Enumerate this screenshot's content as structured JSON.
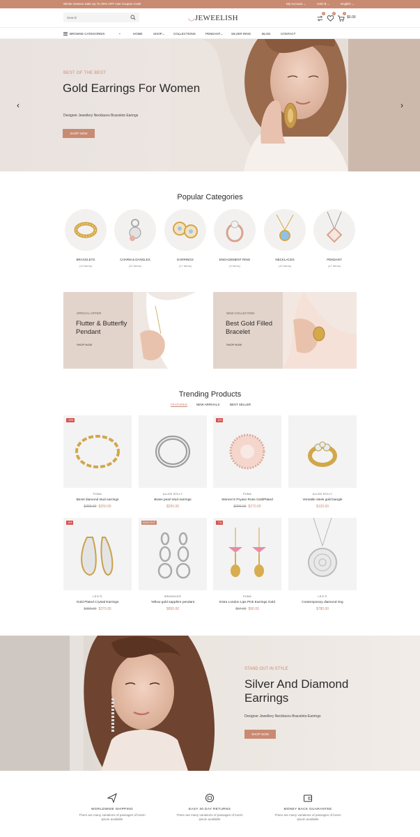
{
  "topbar": {
    "promo": "Winter Season Sale Up To 25% OFF Use Coupon Code",
    "account": "My Account",
    "currency": "USD $",
    "language": "English"
  },
  "header": {
    "search_placeholder": "Search",
    "logo_text": "JEWEELISH",
    "wishlist_count": "0",
    "compare_count": "0",
    "cart_count": "0",
    "cart_total": "$0.00"
  },
  "nav": {
    "browse": "BROWSE CATEGORIES",
    "links": [
      "HOME",
      "SHOP",
      "COLLECTIONS",
      "PENDANT",
      "SILVER RING",
      "BLOG",
      "CONTACT"
    ]
  },
  "hero": {
    "kicker": "BEST OF THE BEST",
    "title": "Gold Earrings For Women",
    "subtitle": "Designer Jewellery Necklaces Bracelets Earings",
    "button": "SHOP NOW"
  },
  "categories": {
    "title": "Popular Categories",
    "items": [
      {
        "name": "BRACELETS",
        "count": "(13 Items)"
      },
      {
        "name": "CHARM & DANGLES",
        "count": "(10 Items)"
      },
      {
        "name": "EARRINGS",
        "count": "(17 Items)"
      },
      {
        "name": "ENGAGEMENT RING",
        "count": "(9 Items)"
      },
      {
        "name": "NECKLACES",
        "count": "(10 Items)"
      },
      {
        "name": "PENDANT",
        "count": "(17 Items)"
      }
    ]
  },
  "promos": [
    {
      "kicker": "SPECIAL OFFER",
      "title": "Flutter & Butterfly Pendant",
      "link": "SHOP NOW"
    },
    {
      "kicker": "NEW COLLECTION",
      "title": "Best Gold Filled Bracelet",
      "link": "SHOP NOW"
    }
  ],
  "trending": {
    "title": "Trending Products",
    "tabs": [
      "FEATURED",
      "NEW ARRIVALS",
      "BEST SELLER"
    ],
    "products": [
      {
        "tag": "-14%",
        "brand": "PUMA",
        "name": "Bezel diamond stud earrings",
        "old_price": "$290.00",
        "price": "$250.00"
      },
      {
        "tag": "",
        "brand": "ALLEN SOLLY",
        "name": "Brass pearl stud earrings",
        "old_price": "",
        "price": "$250.00"
      },
      {
        "tag": "-6%",
        "brand": "PUMA",
        "name": "Women's Pryaso Rose GoldPlated",
        "old_price": "$290.00",
        "price": "$270.00"
      },
      {
        "tag": "",
        "brand": "ALLEN SOLLY",
        "name": "Versatile sleek gold bangle",
        "old_price": "",
        "price": "$120.00"
      },
      {
        "tag": "-8%",
        "brand": "LEVI'S",
        "name": "Gold Plated Crystal Earrings",
        "old_price": "$390.00",
        "price": "$370.00"
      },
      {
        "tag": "SOLD OUT",
        "brand": "WRANGLER",
        "name": "Yellow gold sapphire pendant",
        "old_price": "",
        "price": "$850.00"
      },
      {
        "tag": "-7%",
        "brand": "PUMA",
        "name": "Estra London Lips Pink Earrings Gold",
        "old_price": "$97.00",
        "price": "$90.00"
      },
      {
        "tag": "",
        "brand": "LEVI'S",
        "name": "Contemporary diamond ring",
        "old_price": "",
        "price": "$780.00"
      }
    ]
  },
  "banner2": {
    "kicker": "STAND OUT IN STYLE",
    "title": "Silver And Diamond Earrings",
    "subtitle": "Designer Jewellery Necklaces-Bracelets-Earrings",
    "button": "SHOP NOW"
  },
  "features": [
    {
      "title": "WORLDWIDE SHIPPING",
      "desc": "There are many variations of passages of lorem ipsum available"
    },
    {
      "title": "EASY 30 DAY RETURNS",
      "desc": "There are many variations of passages of lorem ipsum available"
    },
    {
      "title": "MONEY BACK GUARANTEE",
      "desc": "There are many variations of passages of lorem ipsum available"
    }
  ],
  "colors": {
    "accent": "#c98a72",
    "sale_tag": "#d9534f"
  }
}
